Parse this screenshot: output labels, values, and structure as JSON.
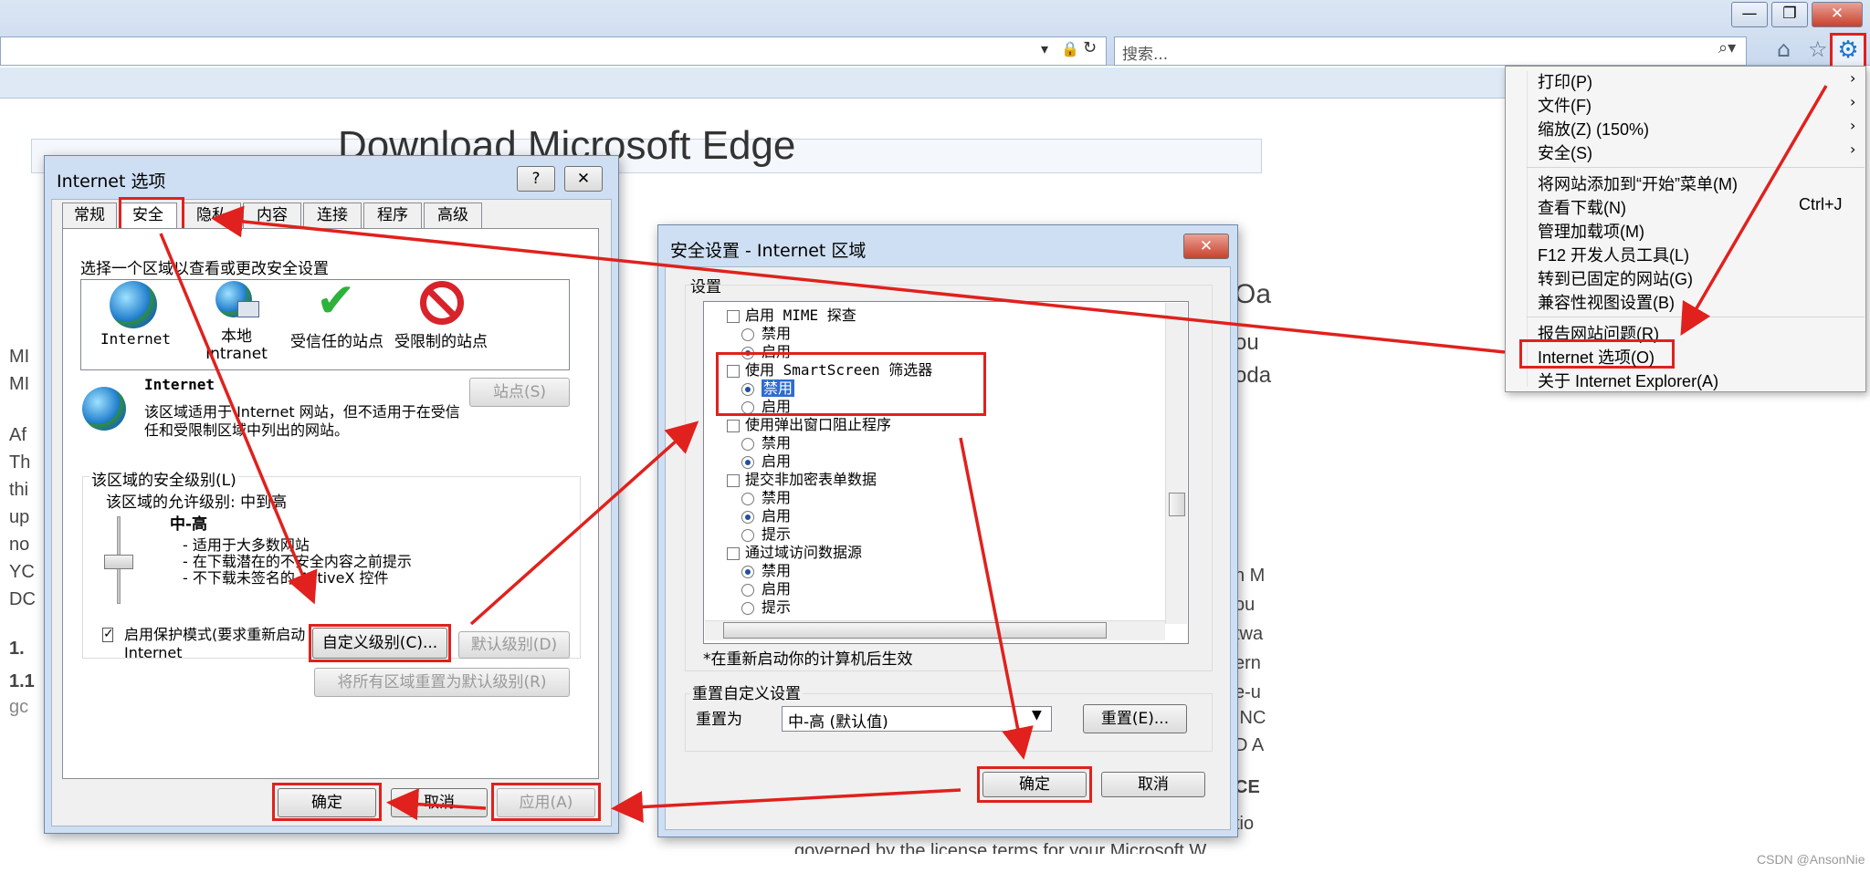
{
  "browser": {
    "search_placeholder": "搜索...",
    "minimize": "—",
    "restore": "❐",
    "close": "✕"
  },
  "background_page": {
    "title_partial": "Download Microsoft Edge",
    "side_letters": [
      "MI",
      "MI",
      "Af",
      "Th",
      "thi",
      "up",
      "no",
      "YC",
      "DC",
      "1.",
      "1.1",
      "gc"
    ],
    "right_fragments": [
      "Oa",
      "ou",
      "oda",
      "n M",
      "ou",
      "twa",
      "ern",
      "e-u",
      "INC",
      "D A",
      "CE",
      "tio"
    ],
    "bottom_text": "governed by the license terms for your Microsoft W"
  },
  "tools_menu": {
    "items": [
      {
        "label": "打印(P)",
        "arrow": "›"
      },
      {
        "label": "文件(F)",
        "arrow": "›"
      },
      {
        "label": "缩放(Z) (150%)",
        "arrow": "›"
      },
      {
        "label": "安全(S)",
        "arrow": "›"
      },
      {
        "label": "将网站添加到“开始”菜单(M)"
      },
      {
        "label": "查看下载(N)",
        "shortcut": "Ctrl+J"
      },
      {
        "label": "管理加载项(M)"
      },
      {
        "label": "F12 开发人员工具(L)"
      },
      {
        "label": "转到已固定的网站(G)"
      },
      {
        "label": "兼容性视图设置(B)"
      },
      {
        "label": "报告网站问题(R)"
      },
      {
        "label": "Internet 选项(O)"
      },
      {
        "label": "关于 Internet Explorer(A)"
      }
    ]
  },
  "internet_options": {
    "title": "Internet 选项",
    "help": "?",
    "close": "✕",
    "tabs": [
      "常规",
      "安全",
      "隐私",
      "内容",
      "连接",
      "程序",
      "高级"
    ],
    "zone_prompt": "选择一个区域以查看或更改安全设置",
    "zones": [
      "Internet",
      "本地\nIntranet",
      "受信任的站点",
      "受限制的站点"
    ],
    "zone_heading": "Internet",
    "sites_button": "站点(S)",
    "zone_desc": "该区域适用于 Internet 网站，但不适用于在受信任和受限制区域中列出的网站。",
    "level_group": "该区域的安全级别(L)",
    "allowed_level": "该区域的允许级别: 中到高",
    "level_name": "中-高",
    "level_bullets": [
      "- 适用于大多数网站",
      "- 在下载潜在的不安全内容之前提示",
      "- 不下载未签名的 ActiveX 控件"
    ],
    "protected_mode": "启用保护模式(要求重新启动 Internet",
    "custom_level": "自定义级别(C)...",
    "default_level": "默认级别(D)",
    "reset_all": "将所有区域重置为默认级别(R)",
    "ok": "确定",
    "cancel": "取消",
    "apply": "应用(A)"
  },
  "security_settings": {
    "title": "安全设置 - Internet 区域",
    "close": "✕",
    "settings_label": "设置",
    "tree": [
      {
        "type": "group",
        "label": "启用 MIME 探查"
      },
      {
        "type": "radio",
        "label": "禁用",
        "on": false
      },
      {
        "type": "radio",
        "label": "启用",
        "on": true
      },
      {
        "type": "group",
        "label": "使用 SmartScreen 筛选器"
      },
      {
        "type": "radio",
        "label": "禁用",
        "on": true,
        "selected": true
      },
      {
        "type": "radio",
        "label": "启用",
        "on": false
      },
      {
        "type": "group",
        "label": "使用弹出窗口阻止程序"
      },
      {
        "type": "radio",
        "label": "禁用",
        "on": false
      },
      {
        "type": "radio",
        "label": "启用",
        "on": true
      },
      {
        "type": "group",
        "label": "提交非加密表单数据"
      },
      {
        "type": "radio",
        "label": "禁用",
        "on": false
      },
      {
        "type": "radio",
        "label": "启用",
        "on": true
      },
      {
        "type": "radio",
        "label": "提示",
        "on": false
      },
      {
        "type": "group",
        "label": "通过域访问数据源"
      },
      {
        "type": "radio",
        "label": "禁用",
        "on": true
      },
      {
        "type": "radio",
        "label": "启用",
        "on": false
      },
      {
        "type": "radio",
        "label": "提示",
        "on": false
      }
    ],
    "restart_note": "*在重新启动你的计算机后生效",
    "reset_group": "重置自定义设置",
    "reset_to": "重置为",
    "reset_value": "中-高 (默认值)",
    "reset_button": "重置(E)...",
    "ok": "确定",
    "cancel": "取消"
  },
  "watermark": "CSDN @AnsonNie",
  "colors": {
    "annotation": "#e0211d",
    "chrome": "#dbe6f4",
    "gear": "#1a73c8"
  }
}
